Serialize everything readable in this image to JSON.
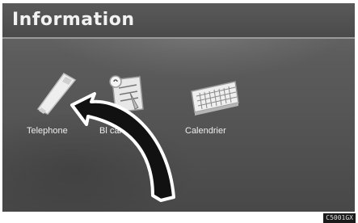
{
  "header": {
    "title": "Information"
  },
  "menu": {
    "items": [
      {
        "label": "Telephone",
        "icon": "telephone-icon"
      },
      {
        "label": "Bloc-notes",
        "label_visible": "Bl    carte",
        "icon": "notepad-icon"
      },
      {
        "label": "Calendrier",
        "icon": "calendar-icon"
      }
    ]
  },
  "footer": {
    "code": "C5001GX"
  },
  "colors": {
    "screen": "#555555",
    "title_text": "#f2f2f2",
    "arrow_fill": "#111111",
    "arrow_outline": "#ffffff"
  }
}
